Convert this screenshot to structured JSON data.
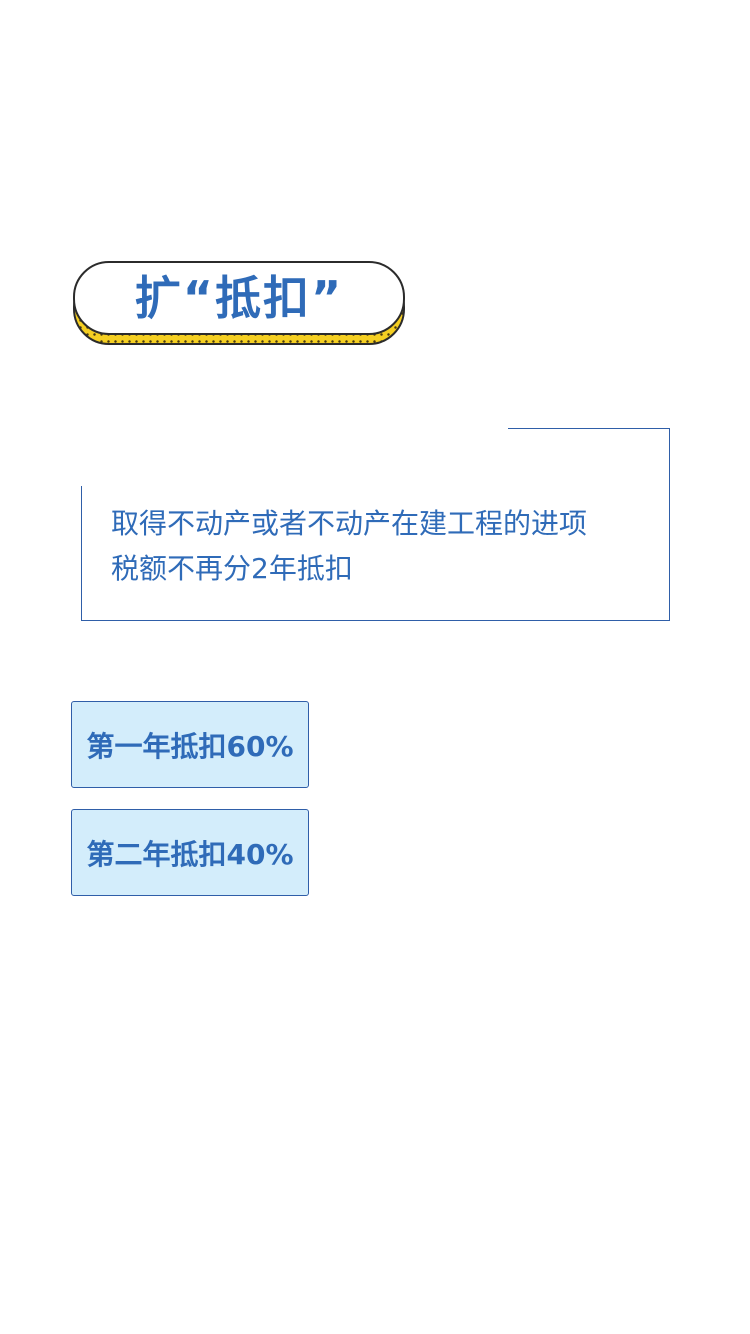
{
  "title": "扩“抵扣”",
  "description": {
    "line1": "取得不动产或者不动产在建工程的进项",
    "line2": "税额不再分2年抵扣"
  },
  "deductions": [
    {
      "label": "第一年抵扣60%"
    },
    {
      "label": "第二年抵扣40%"
    }
  ],
  "colors": {
    "accent_blue": "#2f6bb8",
    "box_fill": "#d3edfb",
    "pill_yellow": "#f5cf22",
    "outline": "#2b2b2b"
  }
}
